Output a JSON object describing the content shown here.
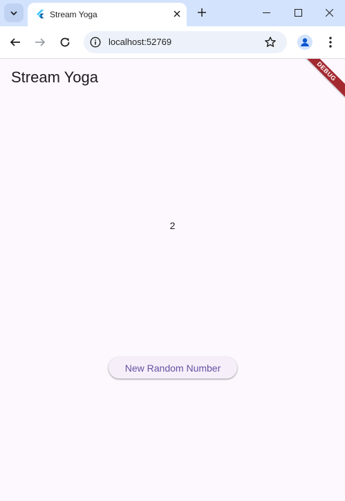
{
  "browser": {
    "tab": {
      "title": "Stream Yoga"
    },
    "address": {
      "url": "localhost:52769"
    }
  },
  "icons": [
    "tab-search-icon",
    "flutter-favicon-icon",
    "close-icon",
    "plus-icon",
    "minimize-icon",
    "maximize-icon",
    "window-close-icon",
    "back-arrow-icon",
    "forward-arrow-icon",
    "reload-icon",
    "info-icon",
    "star-icon",
    "profile-icon",
    "kebab-menu-icon"
  ],
  "app": {
    "title": "Stream Yoga",
    "number": "2",
    "button_label": "New Random Number",
    "debug_banner": "DEBUG"
  },
  "colors": {
    "accent": "#6750a4",
    "background": "#fdf7fe",
    "tabstrip": "#d3e3fd",
    "debug": "#a3292f"
  }
}
